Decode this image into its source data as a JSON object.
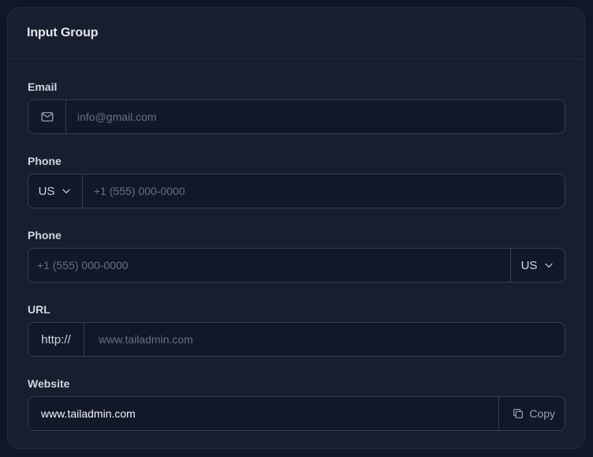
{
  "card": {
    "title": "Input Group"
  },
  "email": {
    "label": "Email",
    "placeholder": "info@gmail.com",
    "icon": "mail-icon"
  },
  "phone1": {
    "label": "Phone",
    "country": "US",
    "placeholder": "+1 (555) 000-0000"
  },
  "phone2": {
    "label": "Phone",
    "country": "US",
    "placeholder": "+1 (555) 000-0000"
  },
  "url": {
    "label": "URL",
    "prefix": "http://",
    "placeholder": "www.tailadmin.com"
  },
  "website": {
    "label": "Website",
    "value": "www.tailadmin.com",
    "copy_label": "Copy",
    "icon": "copy-icon"
  }
}
